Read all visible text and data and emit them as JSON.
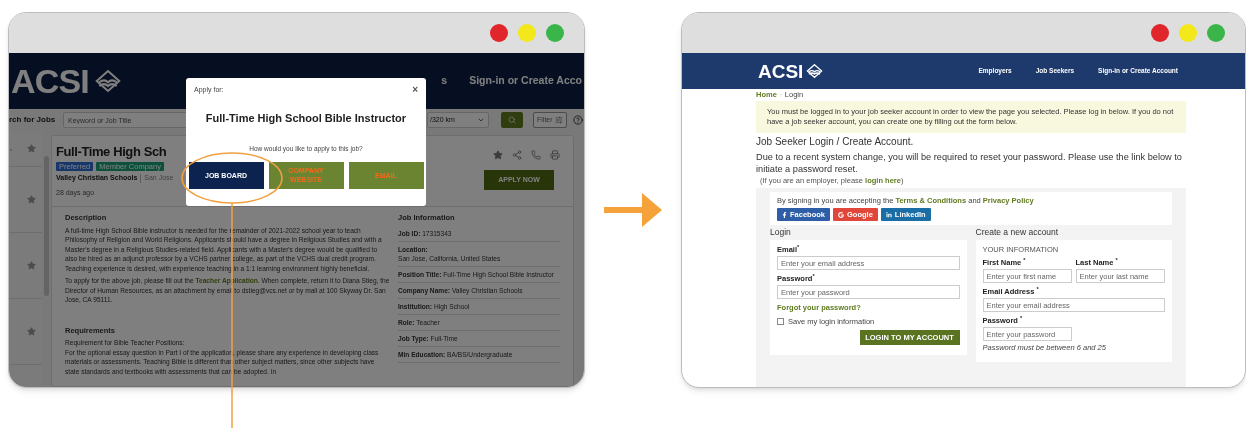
{
  "left_window": {
    "nav": {
      "logo": "ACSI",
      "items": [
        "s",
        "Sign-in or Create Acco"
      ]
    },
    "search_bar": {
      "label": "rch for Jobs",
      "keyword_placeholder": "Keyword or Job Title",
      "distance": "/320 km",
      "filter": "Filter"
    },
    "sidebar_snippet": ",",
    "job": {
      "title": "Full-Time High Sch",
      "badges": [
        {
          "label": "Preferred",
          "kind": "preferred"
        },
        {
          "label": "Member Company",
          "kind": "member"
        }
      ],
      "company": "Valley Christian Schools",
      "location": "San Jose",
      "posted": "28 days ago",
      "apply": "APPLY NOW",
      "description_heading": "Description",
      "description": "A full-time High School Bible instructor is needed for the remainder of 2021-2022 school year to teach Philosophy of Religion and World Religions. Applicants should have a degree in Religious Studies and with a Master's degree in a Religious Studies-related field. Applicants with a Master's degree would be qualified to also be hired as an adjunct professor by a VCHS partner college, as part of the VCHS dual credit program. Teaching experience is desired, with experience teaching in a 1:1 learning environment highly beneficial.",
      "apply_note": {
        "before": "To apply for the above job, please fill out the ",
        "link": "Teacher Application",
        "after": ". When complete, return it to Diana Stieg, the Director of Human Resources, as an attachment by email to dstieg@vcs.net or by mail at 100 Skyway Dr. San Jose, CA 95111."
      },
      "requirements_heading": "Requirements",
      "requirements": [
        "Requirement for Bible Teacher Positions:",
        "For the optional essay question in Part I of the application, please share any experience in developing class materials or assessments. Teaching Bible is different than other subject matters, since other subjects have state standards and textbooks with assessments that can be adopted. In"
      ],
      "info_heading": "Job Information",
      "info": [
        {
          "label": "Job ID:",
          "value": "17315343",
          "kind": "inline"
        },
        {
          "label": "Location:",
          "value": "San Jose, California, United States",
          "kind": "stacked"
        },
        {
          "label": "Position Title:",
          "value": "Full-Time High School Bible Instructor",
          "kind": "inline"
        },
        {
          "label": "Company Name:",
          "value": "Valley Christian Schools",
          "kind": "inline"
        },
        {
          "label": "Institution:",
          "value": "High School",
          "kind": "inline"
        },
        {
          "label": "Role:",
          "value": "Teacher",
          "kind": "inline"
        },
        {
          "label": "Job Type:",
          "value": "Full-Time",
          "kind": "inline"
        },
        {
          "label": "Min Education:",
          "value": "BA/BS/Undergraduate",
          "kind": "inline"
        }
      ]
    },
    "dialog": {
      "label": "Apply for:",
      "close": "×",
      "title": "Full-Time High School Bible Instructor",
      "question": "How would you like to apply to this job?",
      "options": [
        {
          "label": "JOB BOARD",
          "selected": true
        },
        {
          "label": "COMPANY WEBSITE",
          "selected": false
        },
        {
          "label": "EMAIL",
          "selected": false
        }
      ]
    }
  },
  "right_window": {
    "nav": {
      "logo": "ACSI",
      "items": [
        "Employers",
        "Job Seekers",
        "Sign-in or Create Account"
      ]
    },
    "breadcrumb": [
      {
        "label": "Home",
        "kind": "link"
      },
      {
        "label": "Login",
        "kind": "current"
      }
    ],
    "notice": "You must be logged in to your job seeker account in order to view the page you selected. Please log in below. If you do not have a job seeker account, you can create one by filling out the form below.",
    "heading": "Job Seeker Login / Create Account.",
    "message": "Due to a recent system change, you will be required to reset your password. Please use the link below to initiate a password reset.",
    "employer_note": {
      "before": "(If you are an employer, please ",
      "link": "login here",
      "after": ")"
    },
    "terms": {
      "before": "By signing in you are accepting the ",
      "link1": "Terms & Conditions",
      "middle": " and ",
      "link2": "Privacy Policy"
    },
    "social": [
      {
        "label": "Facebook",
        "kind": "facebook"
      },
      {
        "label": "Google",
        "kind": "google"
      },
      {
        "label": "LinkedIn",
        "kind": "linkedin"
      }
    ],
    "login": {
      "title": "Login",
      "fields": [
        {
          "label": "Email$^{*}$",
          "placeholder": "Enter your email address"
        },
        {
          "label": "Password$^{*}$",
          "placeholder": "Enter your password"
        }
      ],
      "forgot": "Forgot your password?",
      "remember": {
        "label": "Save my login information",
        "checked": false
      },
      "submit": "LOGIN TO MY ACCOUNT"
    },
    "create": {
      "title": "Create a new account",
      "section": "YOUR INFORMATION",
      "fields": [
        {
          "label": "First Name $^{*}$",
          "placeholder": "Enter your first name",
          "kind": "half"
        },
        {
          "label": "Last Name $^{*}$",
          "placeholder": "Enter your last name",
          "kind": "half"
        },
        {
          "label": "Email Address $^{*}$",
          "placeholder": "Enter your email address",
          "kind": "full"
        },
        {
          "label": "Password $^{*}$",
          "placeholder": "Enter your password",
          "kind": "half"
        }
      ],
      "hint": "Password must be between 6 and 25"
    }
  }
}
